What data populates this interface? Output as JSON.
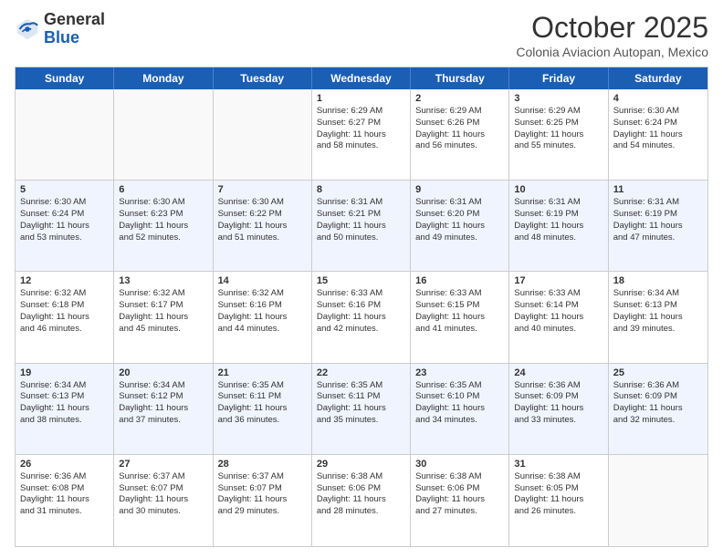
{
  "header": {
    "logo": {
      "general": "General",
      "blue": "Blue",
      "tagline": ""
    },
    "month": "October 2025",
    "location": "Colonia Aviacion Autopan, Mexico"
  },
  "weekdays": [
    "Sunday",
    "Monday",
    "Tuesday",
    "Wednesday",
    "Thursday",
    "Friday",
    "Saturday"
  ],
  "weeks": [
    [
      {
        "day": "",
        "sunrise": "",
        "sunset": "",
        "daylight": "",
        "empty": true
      },
      {
        "day": "",
        "sunrise": "",
        "sunset": "",
        "daylight": "",
        "empty": true
      },
      {
        "day": "",
        "sunrise": "",
        "sunset": "",
        "daylight": "",
        "empty": true
      },
      {
        "day": "1",
        "sunrise": "Sunrise: 6:29 AM",
        "sunset": "Sunset: 6:27 PM",
        "daylight1": "Daylight: 11 hours",
        "daylight2": "and 58 minutes."
      },
      {
        "day": "2",
        "sunrise": "Sunrise: 6:29 AM",
        "sunset": "Sunset: 6:26 PM",
        "daylight1": "Daylight: 11 hours",
        "daylight2": "and 56 minutes."
      },
      {
        "day": "3",
        "sunrise": "Sunrise: 6:29 AM",
        "sunset": "Sunset: 6:25 PM",
        "daylight1": "Daylight: 11 hours",
        "daylight2": "and 55 minutes."
      },
      {
        "day": "4",
        "sunrise": "Sunrise: 6:30 AM",
        "sunset": "Sunset: 6:24 PM",
        "daylight1": "Daylight: 11 hours",
        "daylight2": "and 54 minutes."
      }
    ],
    [
      {
        "day": "5",
        "sunrise": "Sunrise: 6:30 AM",
        "sunset": "Sunset: 6:24 PM",
        "daylight1": "Daylight: 11 hours",
        "daylight2": "and 53 minutes."
      },
      {
        "day": "6",
        "sunrise": "Sunrise: 6:30 AM",
        "sunset": "Sunset: 6:23 PM",
        "daylight1": "Daylight: 11 hours",
        "daylight2": "and 52 minutes."
      },
      {
        "day": "7",
        "sunrise": "Sunrise: 6:30 AM",
        "sunset": "Sunset: 6:22 PM",
        "daylight1": "Daylight: 11 hours",
        "daylight2": "and 51 minutes."
      },
      {
        "day": "8",
        "sunrise": "Sunrise: 6:31 AM",
        "sunset": "Sunset: 6:21 PM",
        "daylight1": "Daylight: 11 hours",
        "daylight2": "and 50 minutes."
      },
      {
        "day": "9",
        "sunrise": "Sunrise: 6:31 AM",
        "sunset": "Sunset: 6:20 PM",
        "daylight1": "Daylight: 11 hours",
        "daylight2": "and 49 minutes."
      },
      {
        "day": "10",
        "sunrise": "Sunrise: 6:31 AM",
        "sunset": "Sunset: 6:19 PM",
        "daylight1": "Daylight: 11 hours",
        "daylight2": "and 48 minutes."
      },
      {
        "day": "11",
        "sunrise": "Sunrise: 6:31 AM",
        "sunset": "Sunset: 6:19 PM",
        "daylight1": "Daylight: 11 hours",
        "daylight2": "and 47 minutes."
      }
    ],
    [
      {
        "day": "12",
        "sunrise": "Sunrise: 6:32 AM",
        "sunset": "Sunset: 6:18 PM",
        "daylight1": "Daylight: 11 hours",
        "daylight2": "and 46 minutes."
      },
      {
        "day": "13",
        "sunrise": "Sunrise: 6:32 AM",
        "sunset": "Sunset: 6:17 PM",
        "daylight1": "Daylight: 11 hours",
        "daylight2": "and 45 minutes."
      },
      {
        "day": "14",
        "sunrise": "Sunrise: 6:32 AM",
        "sunset": "Sunset: 6:16 PM",
        "daylight1": "Daylight: 11 hours",
        "daylight2": "and 44 minutes."
      },
      {
        "day": "15",
        "sunrise": "Sunrise: 6:33 AM",
        "sunset": "Sunset: 6:16 PM",
        "daylight1": "Daylight: 11 hours",
        "daylight2": "and 42 minutes."
      },
      {
        "day": "16",
        "sunrise": "Sunrise: 6:33 AM",
        "sunset": "Sunset: 6:15 PM",
        "daylight1": "Daylight: 11 hours",
        "daylight2": "and 41 minutes."
      },
      {
        "day": "17",
        "sunrise": "Sunrise: 6:33 AM",
        "sunset": "Sunset: 6:14 PM",
        "daylight1": "Daylight: 11 hours",
        "daylight2": "and 40 minutes."
      },
      {
        "day": "18",
        "sunrise": "Sunrise: 6:34 AM",
        "sunset": "Sunset: 6:13 PM",
        "daylight1": "Daylight: 11 hours",
        "daylight2": "and 39 minutes."
      }
    ],
    [
      {
        "day": "19",
        "sunrise": "Sunrise: 6:34 AM",
        "sunset": "Sunset: 6:13 PM",
        "daylight1": "Daylight: 11 hours",
        "daylight2": "and 38 minutes."
      },
      {
        "day": "20",
        "sunrise": "Sunrise: 6:34 AM",
        "sunset": "Sunset: 6:12 PM",
        "daylight1": "Daylight: 11 hours",
        "daylight2": "and 37 minutes."
      },
      {
        "day": "21",
        "sunrise": "Sunrise: 6:35 AM",
        "sunset": "Sunset: 6:11 PM",
        "daylight1": "Daylight: 11 hours",
        "daylight2": "and 36 minutes."
      },
      {
        "day": "22",
        "sunrise": "Sunrise: 6:35 AM",
        "sunset": "Sunset: 6:11 PM",
        "daylight1": "Daylight: 11 hours",
        "daylight2": "and 35 minutes."
      },
      {
        "day": "23",
        "sunrise": "Sunrise: 6:35 AM",
        "sunset": "Sunset: 6:10 PM",
        "daylight1": "Daylight: 11 hours",
        "daylight2": "and 34 minutes."
      },
      {
        "day": "24",
        "sunrise": "Sunrise: 6:36 AM",
        "sunset": "Sunset: 6:09 PM",
        "daylight1": "Daylight: 11 hours",
        "daylight2": "and 33 minutes."
      },
      {
        "day": "25",
        "sunrise": "Sunrise: 6:36 AM",
        "sunset": "Sunset: 6:09 PM",
        "daylight1": "Daylight: 11 hours",
        "daylight2": "and 32 minutes."
      }
    ],
    [
      {
        "day": "26",
        "sunrise": "Sunrise: 6:36 AM",
        "sunset": "Sunset: 6:08 PM",
        "daylight1": "Daylight: 11 hours",
        "daylight2": "and 31 minutes."
      },
      {
        "day": "27",
        "sunrise": "Sunrise: 6:37 AM",
        "sunset": "Sunset: 6:07 PM",
        "daylight1": "Daylight: 11 hours",
        "daylight2": "and 30 minutes."
      },
      {
        "day": "28",
        "sunrise": "Sunrise: 6:37 AM",
        "sunset": "Sunset: 6:07 PM",
        "daylight1": "Daylight: 11 hours",
        "daylight2": "and 29 minutes."
      },
      {
        "day": "29",
        "sunrise": "Sunrise: 6:38 AM",
        "sunset": "Sunset: 6:06 PM",
        "daylight1": "Daylight: 11 hours",
        "daylight2": "and 28 minutes."
      },
      {
        "day": "30",
        "sunrise": "Sunrise: 6:38 AM",
        "sunset": "Sunset: 6:06 PM",
        "daylight1": "Daylight: 11 hours",
        "daylight2": "and 27 minutes."
      },
      {
        "day": "31",
        "sunrise": "Sunrise: 6:38 AM",
        "sunset": "Sunset: 6:05 PM",
        "daylight1": "Daylight: 11 hours",
        "daylight2": "and 26 minutes."
      },
      {
        "day": "",
        "sunrise": "",
        "sunset": "",
        "daylight1": "",
        "daylight2": "",
        "empty": true
      }
    ]
  ]
}
